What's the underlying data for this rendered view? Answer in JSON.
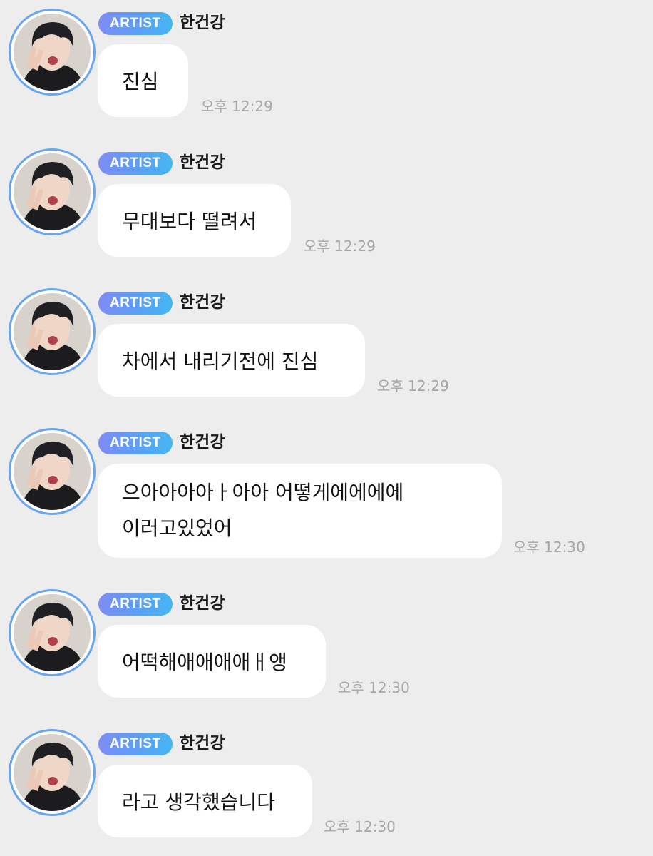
{
  "messages": [
    {
      "badge": "ARTIST",
      "name": "한건강",
      "lines": [
        "진심"
      ],
      "time": "오후 12:29"
    },
    {
      "badge": "ARTIST",
      "name": "한건강",
      "lines": [
        "무대보다 떨려서"
      ],
      "time": "오후 12:29"
    },
    {
      "badge": "ARTIST",
      "name": "한건강",
      "lines": [
        "차에서 내리기전에 진심"
      ],
      "time": "오후 12:29"
    },
    {
      "badge": "ARTIST",
      "name": "한건강",
      "lines": [
        "으아아아아ㅏ아아 어떻게에에에에",
        "이러고있었어"
      ],
      "time": "오후 12:30"
    },
    {
      "badge": "ARTIST",
      "name": "한건강",
      "lines": [
        "어떡해애애애애ㅐ앵"
      ],
      "time": "오후 12:30"
    },
    {
      "badge": "ARTIST",
      "name": "한건강",
      "lines": [
        "라고 생각했습니다"
      ],
      "time": "오후 12:30"
    }
  ],
  "colors": {
    "background": "#ededed",
    "bubble": "#ffffff",
    "badge_gradient_start": "#7f8cf3",
    "badge_gradient_end": "#44b7f2",
    "avatar_ring": "#6aa6ee",
    "timestamp": "#a6a6a6"
  },
  "icons": {
    "avatar": "profile-photo"
  }
}
